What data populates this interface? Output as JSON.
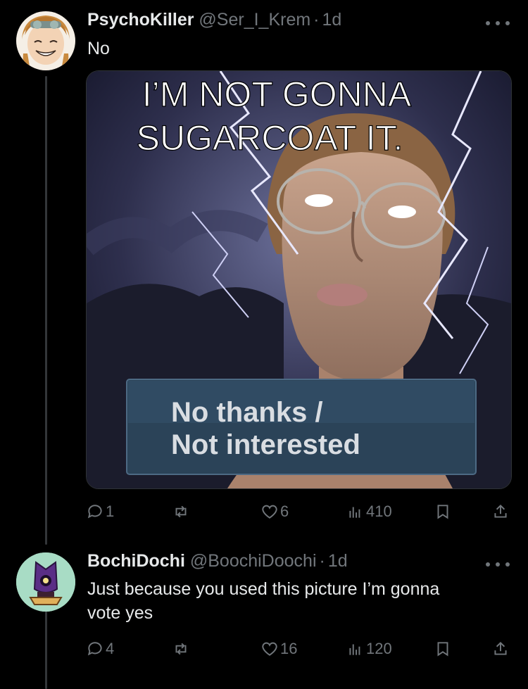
{
  "tweets": [
    {
      "display_name": "PsychoKiller",
      "handle": "@Ser_I_Krem",
      "dot": "·",
      "time": "1d",
      "text": "No",
      "media": {
        "caption_top": [
          "I’M NOT GONNA",
          "SUGARCOAT IT."
        ],
        "button_text": [
          "No thanks /",
          "Not interested"
        ]
      },
      "actions": {
        "replies": "1",
        "retweets": "",
        "likes": "6",
        "views": "410"
      }
    },
    {
      "display_name": "BochiDochi",
      "handle": "@BoochiDoochi",
      "dot": "·",
      "time": "1d",
      "text_lines": [
        "Just because you used this picture I’m gonna",
        "vote yes"
      ],
      "actions": {
        "replies": "4",
        "retweets": "",
        "likes": "16",
        "views": "120"
      }
    }
  ],
  "icons": [
    "more-icon",
    "reply-icon",
    "retweet-icon",
    "like-icon",
    "views-icon",
    "bookmark-icon",
    "share-icon"
  ],
  "colors": {
    "background": "#000000",
    "text": "#e7e9ea",
    "muted": "#71767b",
    "divider": "#333639"
  }
}
